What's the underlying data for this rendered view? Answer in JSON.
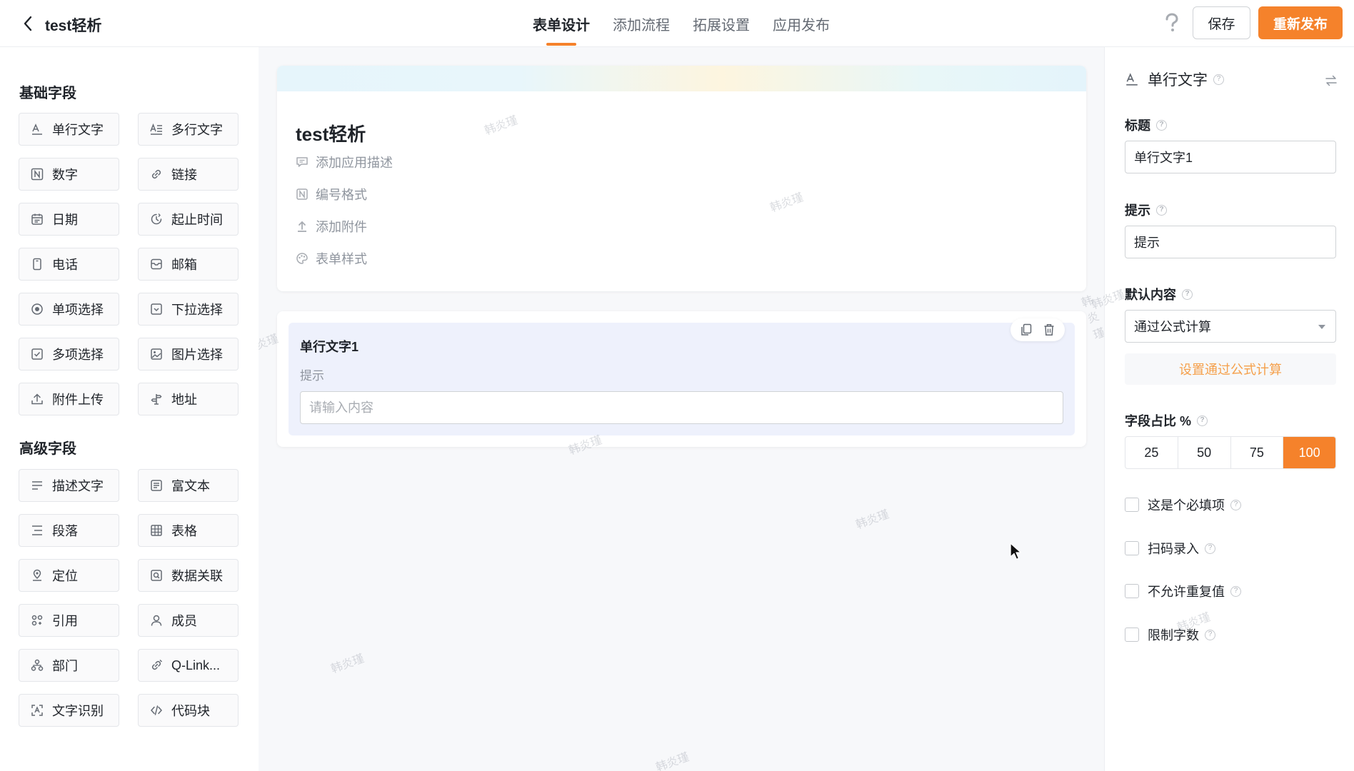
{
  "header": {
    "app_title": "test轻析",
    "tabs": [
      "表单设计",
      "添加流程",
      "拓展设置",
      "应用发布"
    ],
    "active_tab": 0,
    "save_label": "保存",
    "publish_label": "重新发布",
    "accent_color": "#f5822b"
  },
  "left_panel": {
    "basic_title": "基础字段",
    "basic_fields": [
      {
        "label": "单行文字",
        "icon": "text-line-icon"
      },
      {
        "label": "多行文字",
        "icon": "text-multiline-icon"
      },
      {
        "label": "数字",
        "icon": "number-icon"
      },
      {
        "label": "链接",
        "icon": "link-icon"
      },
      {
        "label": "日期",
        "icon": "calendar-icon"
      },
      {
        "label": "起止时间",
        "icon": "time-range-icon"
      },
      {
        "label": "电话",
        "icon": "phone-icon"
      },
      {
        "label": "邮箱",
        "icon": "mail-icon"
      },
      {
        "label": "单项选择",
        "icon": "radio-icon"
      },
      {
        "label": "下拉选择",
        "icon": "dropdown-icon"
      },
      {
        "label": "多项选择",
        "icon": "checkbox-icon"
      },
      {
        "label": "图片选择",
        "icon": "image-icon"
      },
      {
        "label": "附件上传",
        "icon": "upload-icon"
      },
      {
        "label": "地址",
        "icon": "location-pin-icon"
      }
    ],
    "advanced_title": "高级字段",
    "advanced_fields": [
      {
        "label": "描述文字",
        "icon": "description-icon"
      },
      {
        "label": "富文本",
        "icon": "rich-text-icon"
      },
      {
        "label": "段落",
        "icon": "paragraph-icon"
      },
      {
        "label": "表格",
        "icon": "table-icon"
      },
      {
        "label": "定位",
        "icon": "locate-icon"
      },
      {
        "label": "数据关联",
        "icon": "data-link-icon"
      },
      {
        "label": "引用",
        "icon": "reference-icon"
      },
      {
        "label": "成员",
        "icon": "member-icon"
      },
      {
        "label": "部门",
        "icon": "department-icon"
      },
      {
        "label": "Q-Link...",
        "icon": "qlink-icon"
      },
      {
        "label": "文字识别",
        "icon": "ocr-icon"
      },
      {
        "label": "代码块",
        "icon": "code-icon"
      }
    ]
  },
  "canvas": {
    "form_title": "test轻析",
    "options": [
      {
        "label": "添加应用描述",
        "icon": "comment-icon"
      },
      {
        "label": "编号格式",
        "icon": "number-format-icon"
      },
      {
        "label": "添加附件",
        "icon": "upload-icon"
      },
      {
        "label": "表单样式",
        "icon": "palette-icon"
      }
    ],
    "field": {
      "title": "单行文字1",
      "hint": "提示",
      "placeholder": "请输入内容"
    },
    "watermark": "韩炎瑾"
  },
  "right_panel": {
    "field_type": "单行文字",
    "title_label": "标题",
    "title_value": "单行文字1",
    "hint_label": "提示",
    "hint_value": "提示",
    "default_label": "默认内容",
    "default_value": "通过公式计算",
    "formula_button": "设置通过公式计算",
    "ratio_label": "字段占比 %",
    "ratio_options": [
      "25",
      "50",
      "75",
      "100"
    ],
    "ratio_selected": "100",
    "checks": [
      {
        "label": "这是个必填项",
        "checked": false
      },
      {
        "label": "扫码录入",
        "checked": false
      },
      {
        "label": "不允许重复值",
        "checked": false
      },
      {
        "label": "限制字数",
        "checked": false
      }
    ]
  }
}
